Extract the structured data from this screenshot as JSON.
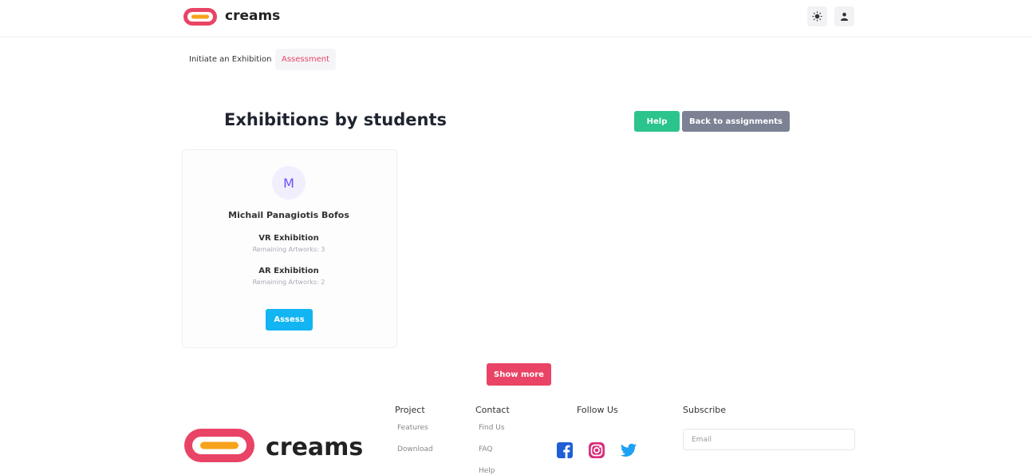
{
  "header": {
    "brand": "creams",
    "theme_icon": "sun-icon",
    "user_icon": "user-icon"
  },
  "tabs": [
    {
      "label": "Initiate an Exhibition",
      "active": false
    },
    {
      "label": "Assessment",
      "active": true
    }
  ],
  "main": {
    "title": "Exhibitions by students",
    "help_label": "Help",
    "back_label": "Back to assignments",
    "show_more_label": "Show more"
  },
  "card": {
    "avatar_letter": "M",
    "student_name": "Michail Panagiotis Bofos",
    "exhibitions": [
      {
        "title": "VR Exhibition",
        "remaining": "Remaining Artworks: 3"
      },
      {
        "title": "AR Exhibition",
        "remaining": "Remaining Artworks: 2"
      }
    ],
    "assess_label": "Assess"
  },
  "footer": {
    "brand": "creams",
    "project": {
      "heading": "Project",
      "links": [
        "Features",
        "Download"
      ]
    },
    "contact": {
      "heading": "Contact",
      "links": [
        "Find Us",
        "FAQ",
        "Help"
      ]
    },
    "follow": {
      "heading": "Follow Us",
      "icons": [
        "facebook-icon",
        "instagram-icon",
        "twitter-icon"
      ]
    },
    "subscribe": {
      "heading": "Subscribe",
      "placeholder": "Email"
    }
  },
  "colors": {
    "accent": "#e94465",
    "help": "#2bc48d",
    "back": "#7c8194",
    "assess": "#12b4f2",
    "avatar_text": "#6c4ff5"
  }
}
